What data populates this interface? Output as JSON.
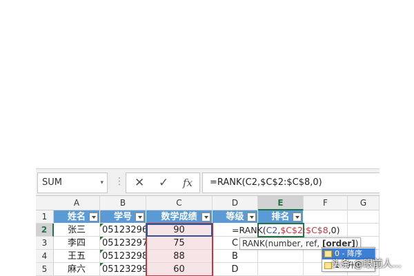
{
  "formula_bar": {
    "name_box": "SUM",
    "name_box_arrow": "▾",
    "separator": "⋮",
    "cancel_icon": "✕",
    "enter_icon": "✓",
    "fx_label": "fx",
    "formula": "=RANK(C2,$C$2:$C$8,0)"
  },
  "columns": [
    "A",
    "B",
    "C",
    "D",
    "E",
    "F",
    "G"
  ],
  "rows": [
    "1",
    "2",
    "3",
    "4",
    "5"
  ],
  "header_row": [
    "姓名",
    "学号",
    "数学成绩",
    "等级",
    "排名"
  ],
  "data": [
    {
      "name": "张三",
      "id": "05123296",
      "score": "90",
      "grade": ""
    },
    {
      "name": "李四",
      "id": "05123297",
      "score": "75",
      "grade": "C"
    },
    {
      "name": "王五",
      "id": "05123298",
      "score": "88",
      "grade": "B"
    },
    {
      "name": "麻六",
      "id": "05123299",
      "score": "60",
      "grade": "D"
    }
  ],
  "active_cell_formula": {
    "prefix": "=RANK(",
    "ref1": "C2",
    "comma1": ",",
    "ref2": "$C$2:$C$8",
    "suffix": ",0)"
  },
  "tooltip": {
    "text": "RANK(number, ref, ",
    "bold": "[order]",
    "close": ")"
  },
  "autocomplete": [
    {
      "label": "0 - 降序",
      "selected": true
    },
    {
      "label": "1 - 升序",
      "selected": false
    }
  ],
  "watermark": "头条 @眼前人..."
}
